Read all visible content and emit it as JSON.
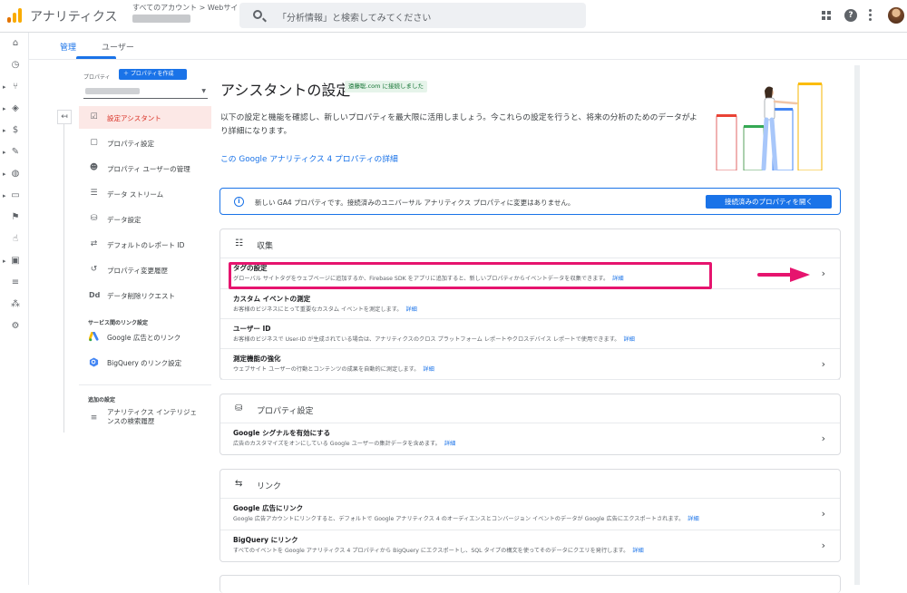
{
  "topbar": {
    "app_title": "アナリティクス",
    "account_path": "すべてのアカウント > Webサイト",
    "search_placeholder": "「分析情報」と検索してみてください"
  },
  "tabs": [
    {
      "label": "管理",
      "active": true
    },
    {
      "label": "ユーザー",
      "active": false
    }
  ],
  "sidebar": {
    "property_label": "プロパティ",
    "create_button": "＋ プロパティを作成",
    "items": [
      {
        "label": "設定アシスタント",
        "icon": "checkbox-icon",
        "active": true
      },
      {
        "label": "プロパティ設定",
        "icon": "property-settings-icon"
      },
      {
        "label": "プロパティ ユーザーの管理",
        "icon": "users-icon"
      },
      {
        "label": "データ ストリーム",
        "icon": "data-stream-icon"
      },
      {
        "label": "データ設定",
        "icon": "database-icon"
      },
      {
        "label": "デフォルトのレポート ID",
        "icon": "report-id-icon"
      },
      {
        "label": "プロパティ変更履歴",
        "icon": "history-icon"
      },
      {
        "label": "データ削除リクエスト",
        "icon": "data-delete-icon"
      }
    ],
    "links_heading": "サービス間のリンク設定",
    "link_items": [
      {
        "label": "Google 広告とのリンク",
        "icon": "google-ads-icon"
      },
      {
        "label": "BigQuery のリンク設定",
        "icon": "bigquery-icon"
      }
    ],
    "extra_heading": "追加の設定",
    "extra_items": [
      {
        "label": "アナリティクス インテリジェンスの検索履歴",
        "icon": "search-history-icon"
      }
    ]
  },
  "main": {
    "title": "アシスタントの設定",
    "connected_badge": "遠藤聡.com に接続しました",
    "intro": "以下の設定と機能を確認し、新しいプロパティを最大限に活用しましょう。今これらの設定を行うと、将来の分析のためのデータがより詳細になります。",
    "detail_link": "この Google アナリティクス 4 プロパティの詳細",
    "banner_text": "新しい GA4 プロパティです。接続済みのユニバーサル アナリティクス プロパティに変更はありません。",
    "banner_button": "接続済みのプロパティを開く",
    "detail_label": "詳細",
    "sections": [
      {
        "title": "収集",
        "icon": "sliders-icon",
        "rows": [
          {
            "title": "タグの設定",
            "desc": "グローバル サイトタグをウェブページに追加するか、Firebase SDK をアプリに追加すると、新しいプロパティからイベントデータを収集できます。",
            "chevron": true
          },
          {
            "title": "カスタム イベントの測定",
            "desc": "お客様のビジネスにとって重要なカスタム イベントを測定します。",
            "chevron": false
          },
          {
            "title": "ユーザー ID",
            "desc": "お客様のビジネスで User-ID が生成されている場合は、アナリティクスのクロス プラットフォーム レポートやクロスデバイス レポートで使用できます。",
            "chevron": false
          },
          {
            "title": "測定機能の強化",
            "desc": "ウェブサイト ユーザーの行動とコンテンツの成果を自動的に測定します。",
            "chevron": true
          }
        ]
      },
      {
        "title": "プロパティ設定",
        "icon": "database-icon",
        "rows": [
          {
            "title": "Google シグナルを有効にする",
            "desc": "広告のカスタマイズをオンにしている Google ユーザーの集計データを含めます。",
            "chevron": true
          }
        ]
      },
      {
        "title": "リンク",
        "icon": "link-icon",
        "rows": [
          {
            "title": "Google 広告にリンク",
            "desc": "Google 広告アカウントにリンクすると、デフォルトで Google アナリティクス 4 のオーディエンスとコンバージョン イベントのデータが Google 広告にエクスポートされます。",
            "chevron": true
          },
          {
            "title": "BigQuery にリンク",
            "desc": "すべてのイベントを Google アナリティクス 4 プロパティから BigQuery にエクスポートし、SQL タイプの構文を使ってそのデータにクエリを発行します。",
            "chevron": true
          }
        ]
      }
    ]
  },
  "colors": {
    "accent": "#1a73e8",
    "active_nav": "#d93025",
    "highlight": "#e6146e",
    "badge_bg": "#e6f4ea"
  }
}
